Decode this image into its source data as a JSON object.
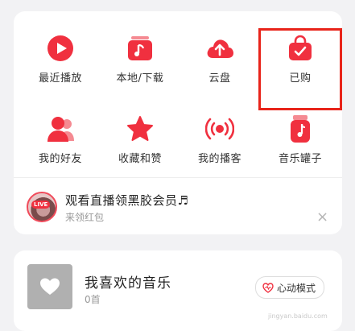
{
  "grid": [
    {
      "label": "最近播放",
      "icon": "play-circle-icon"
    },
    {
      "label": "本地/下载",
      "icon": "music-folder-icon"
    },
    {
      "label": "云盘",
      "icon": "cloud-upload-icon"
    },
    {
      "label": "已购",
      "icon": "shopping-bag-check-icon"
    },
    {
      "label": "我的好友",
      "icon": "friends-icon"
    },
    {
      "label": "收藏和赞",
      "icon": "star-icon"
    },
    {
      "label": "我的播客",
      "icon": "podcast-broadcast-icon"
    },
    {
      "label": "音乐罐子",
      "icon": "music-jar-icon"
    }
  ],
  "banner": {
    "live_tag": "LIVE",
    "title": "观看直播领黑胶会员♬",
    "subtitle": "来领红包",
    "close": "×"
  },
  "favorite": {
    "title": "我喜欢的音乐",
    "count": "0首",
    "mode_button": "心动模式"
  },
  "watermark": "jingyan.baidu.com",
  "colors": {
    "accent": "#f0303f",
    "highlight": "#e8241a"
  }
}
